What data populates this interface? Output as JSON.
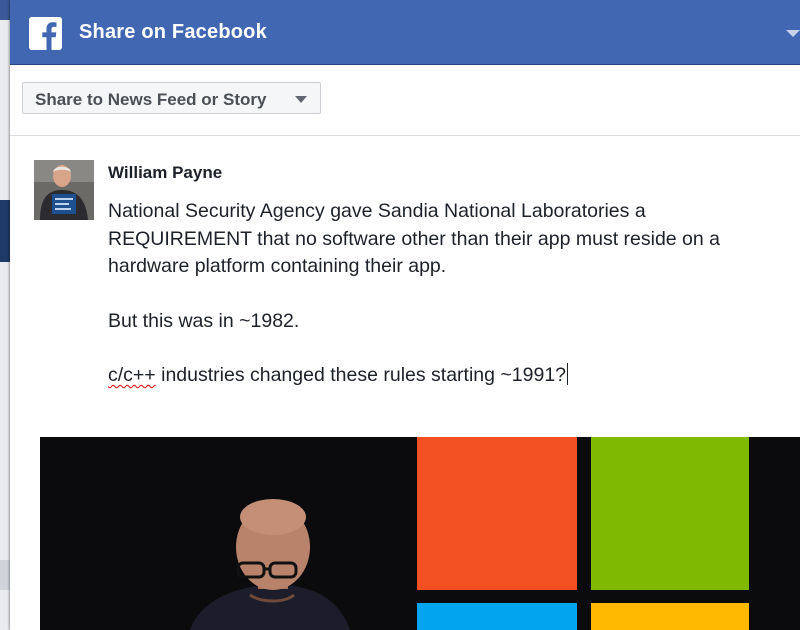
{
  "dialog": {
    "title": "Share on Facebook",
    "colors": {
      "header": "#4267b2",
      "brand": "#3b5998"
    }
  },
  "share_target": {
    "label": "Share to News Feed or Story"
  },
  "post": {
    "author": "William Payne",
    "paragraphs": [
      "National Security Agency gave Sandia National Laboratories a REQUIREMENT that no software other than their app must reside on a hardware platform containing their app.",
      "But this was in ~1982."
    ],
    "last_line": {
      "misspelled_word": "c/c++",
      "rest": " industries changed these rules starting ~1991?"
    }
  },
  "attachment": {
    "type": "image",
    "colors": [
      "#f25022",
      "#7fba00",
      "#00a4ef",
      "#ffb900"
    ]
  }
}
